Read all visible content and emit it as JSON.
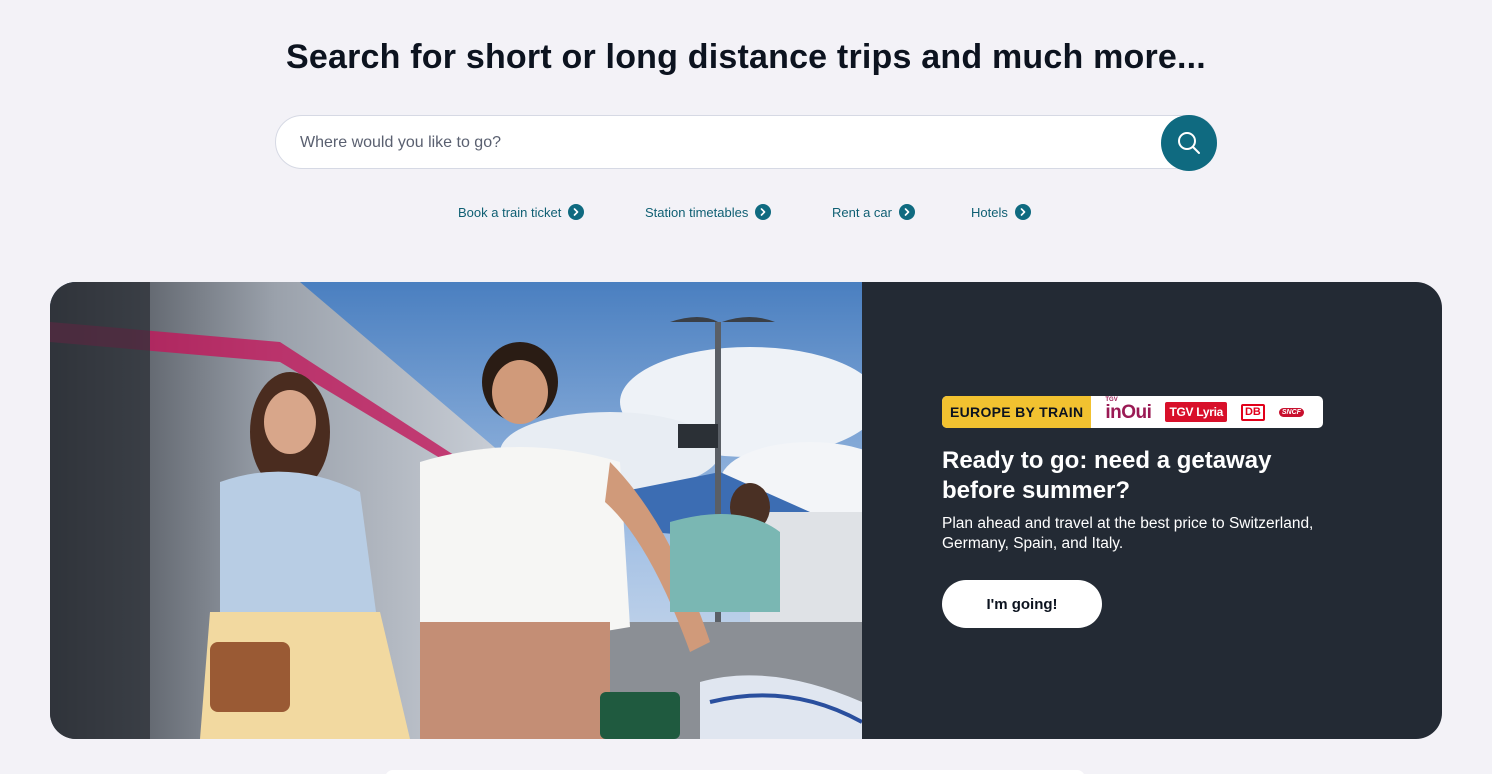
{
  "hero": {
    "title": "Search for short or long distance trips and much more..."
  },
  "search": {
    "placeholder": "Where would you like to go?",
    "button_icon": "search-icon"
  },
  "quick_links": [
    {
      "label": "Book a train ticket",
      "icon": "chevron-right-icon"
    },
    {
      "label": "Station timetables",
      "icon": "chevron-right-icon"
    },
    {
      "label": "Rent a car",
      "icon": "chevron-right-icon"
    },
    {
      "label": "Hotels",
      "icon": "chevron-right-icon"
    }
  ],
  "promo": {
    "badge": "EUROPE BY TRAIN",
    "logos": {
      "inoui_small": "TGV",
      "inoui": "inOui",
      "lyria": "TGV Lyria",
      "db": "DB",
      "sncf": "SNCF"
    },
    "title": "Ready to go: need a getaway before summer?",
    "text": "Plan ahead and travel at the best price to Switzerland, Germany, Spain, and Italy.",
    "button": "I'm going!",
    "image_description_icon": "travelers-on-platform-photo"
  },
  "colors": {
    "background": "#f3f2f7",
    "accent": "#0f6a80",
    "card_dark": "#232a34",
    "badge_yellow": "#f2c230"
  }
}
